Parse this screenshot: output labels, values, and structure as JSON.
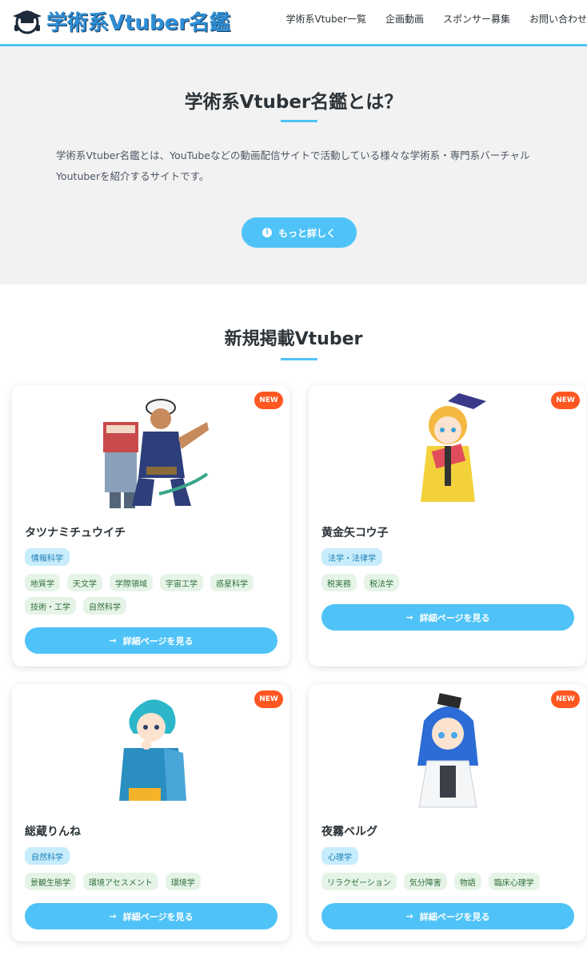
{
  "header": {
    "logo_text": "学術系Vtuber名鑑",
    "nav": [
      "学術系Vtuber一覧",
      "企画動画",
      "スポンサー募集",
      "お問い合わせ"
    ]
  },
  "intro": {
    "title": "学術系Vtuber名鑑とは？",
    "text": "学術系Vtuber名鑑とは、YouTubeなどの動画配信サイトで活動している様々な学術系・専門系バーチャルYoutuberを紹介するサイトです。",
    "button": "もっと詳しく"
  },
  "new_section": {
    "title": "新規掲載Vtuber",
    "badge": "NEW",
    "detail_button": "詳細ページを見る",
    "cards": [
      {
        "name": "タツナミチュウイチ",
        "main_tag": "情報科学",
        "sub_tags": [
          "地質学",
          "天文学",
          "学際領域",
          "宇宙工学",
          "惑星科学",
          "技術・工学",
          "自然科学"
        ]
      },
      {
        "name": "黄金矢コウ子",
        "main_tag": "法学・法律学",
        "sub_tags": [
          "税実務",
          "税法学"
        ]
      },
      {
        "name": "総蔵りんね",
        "main_tag": "自然科学",
        "sub_tags": [
          "景観生態学",
          "環境アセスメント",
          "環境学"
        ]
      },
      {
        "name": "夜霧ベルグ",
        "main_tag": "心理学",
        "sub_tags": [
          "リラクゼーション",
          "気分障害",
          "物語",
          "臨床心理学"
        ]
      }
    ]
  },
  "colors": {
    "accent": "#4fc3f7",
    "new_badge": "#ff5722",
    "main_tag_bg": "#c7ecfb",
    "sub_tag_bg": "#e6f4e8"
  }
}
